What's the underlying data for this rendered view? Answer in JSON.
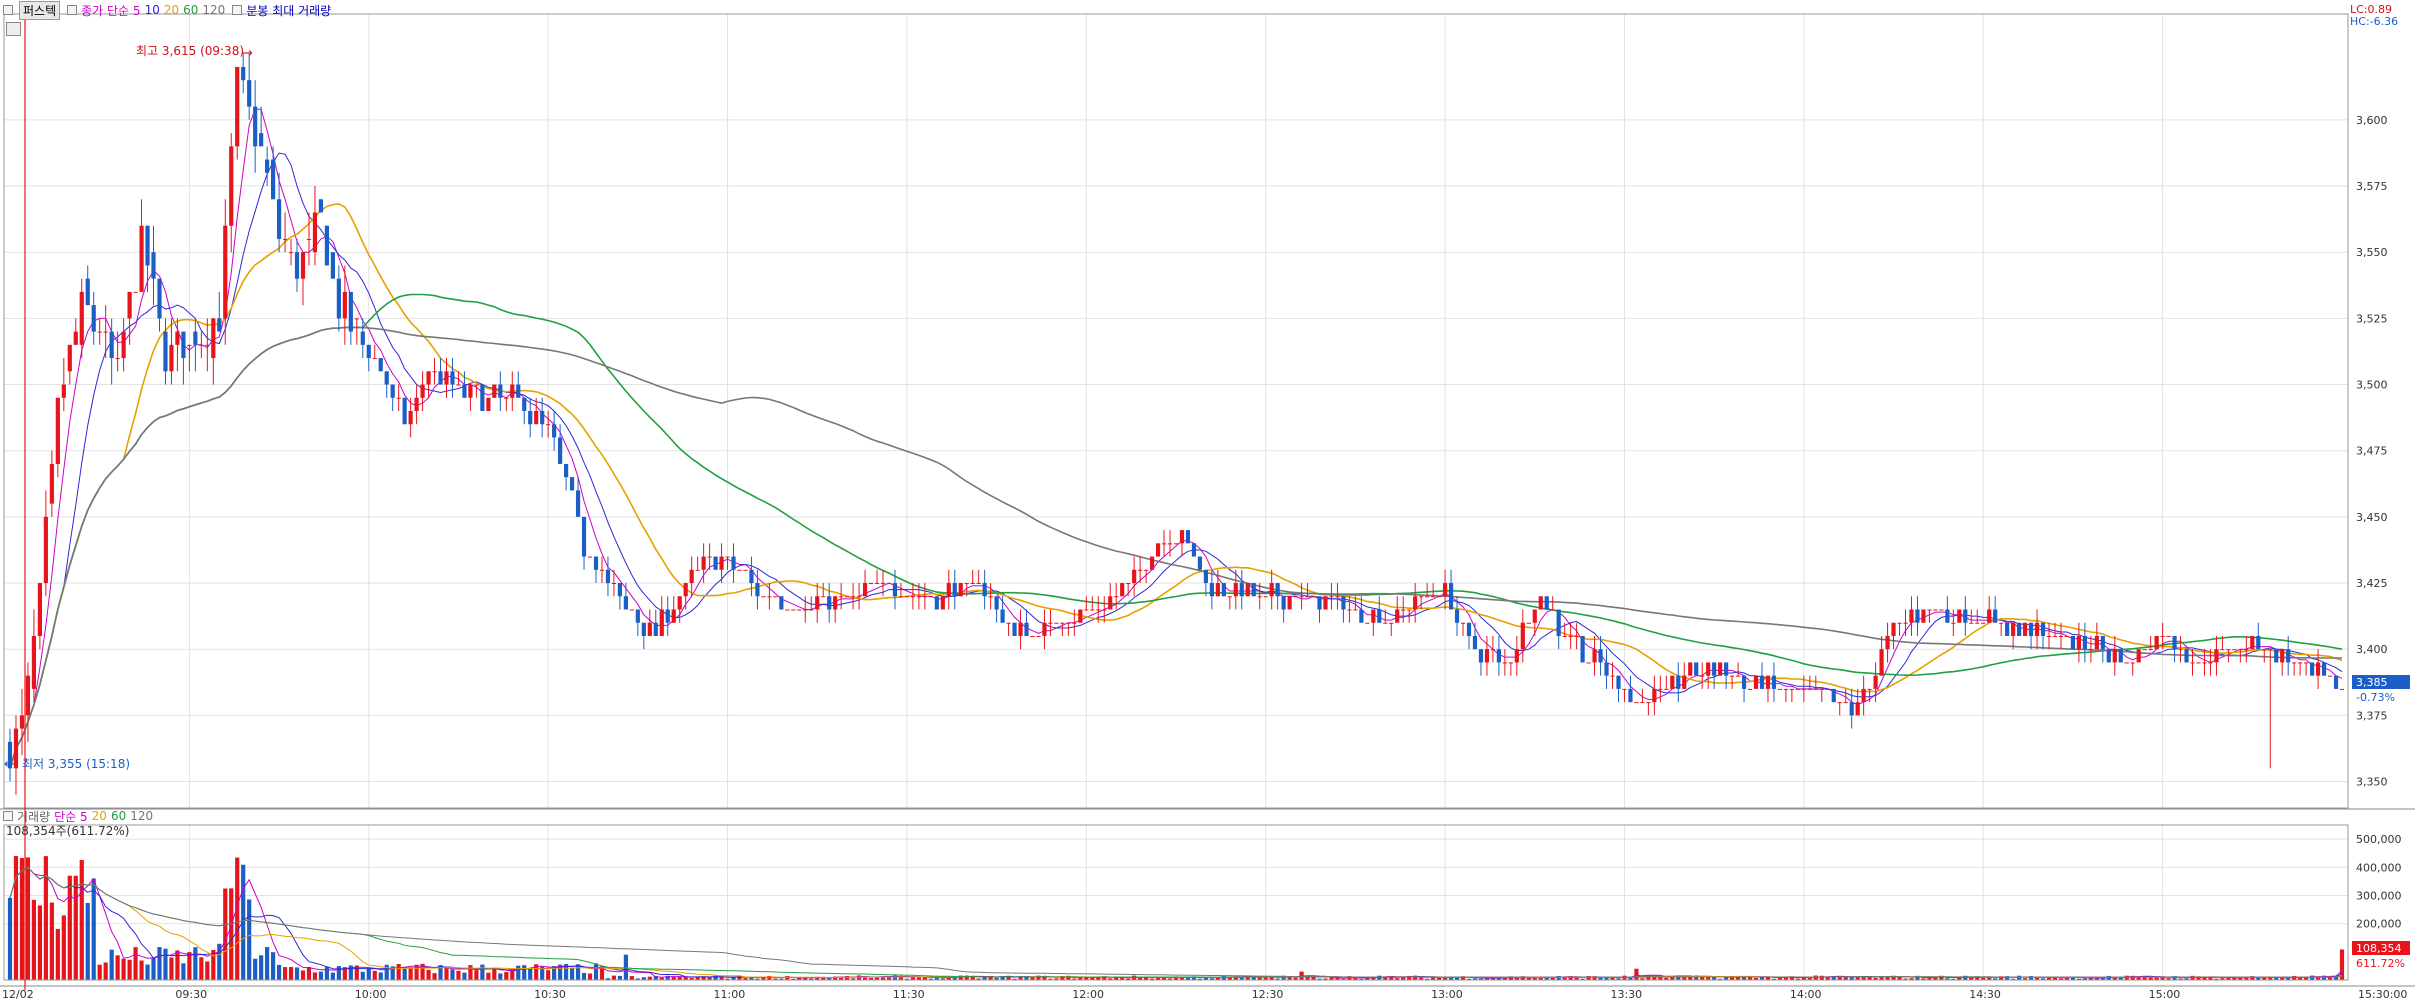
{
  "title_bar": {
    "name": "퍼스텍",
    "legend": [
      {
        "label": "종가 단순 5",
        "color": "#cc00cc"
      },
      {
        "label": "10",
        "color": "#2a2ad8"
      },
      {
        "label": "20",
        "color": "#e8a000"
      },
      {
        "label": "60",
        "color": "#20a040"
      },
      {
        "label": "120",
        "color": "#777777"
      },
      {
        "label": "분봉 최대 거래량",
        "color": "#0000c0"
      }
    ],
    "lc": "LC:0.89",
    "hc": "HC:-6.36"
  },
  "price_panel": {
    "high_label": "최고 3,615 (09:38)",
    "low_label": "최저 3,355 (15:18)",
    "current_price": "3,385",
    "current_change": "-0.73%",
    "y_ticks": [
      "3,600",
      "3,575",
      "3,550",
      "3,525",
      "3,500",
      "3,475",
      "3,450",
      "3,425",
      "3,400",
      "3,375",
      "3,350"
    ]
  },
  "volume_panel": {
    "legend": [
      {
        "label": "거래량",
        "color": "#666666"
      },
      {
        "label": "단순 5",
        "color": "#cc00cc"
      },
      {
        "label": "20",
        "color": "#e8a000"
      },
      {
        "label": "60",
        "color": "#20a040"
      },
      {
        "label": "120",
        "color": "#777777"
      }
    ],
    "value_label": "108,354주(611.72%)",
    "current_volume": "108,354",
    "current_pct": "611.72%",
    "y_ticks": [
      "500,000",
      "400,000",
      "300,000",
      "200,000"
    ]
  },
  "x_axis": {
    "date_label": "12/02",
    "ticks": [
      "09:30",
      "10:00",
      "10:30",
      "11:00",
      "11:30",
      "12:00",
      "12:30",
      "13:00",
      "13:30",
      "14:00",
      "14:30",
      "15:00"
    ],
    "end_label": "15:30:00"
  },
  "chart_data": {
    "type": "candlestick",
    "interval": "1 minute",
    "ylim": [
      3340,
      3640
    ],
    "volume_ylim": [
      0,
      550000
    ],
    "time_range": [
      "09:00",
      "15:30"
    ],
    "series": [
      {
        "name": "종가 단순 5",
        "kind": "moving-average"
      },
      {
        "name": "10",
        "kind": "moving-average"
      },
      {
        "name": "20",
        "kind": "moving-average"
      },
      {
        "name": "60",
        "kind": "moving-average"
      },
      {
        "name": "120",
        "kind": "moving-average"
      }
    ],
    "key_points": [
      {
        "time": "09:38",
        "price": 3615,
        "label": "최고"
      },
      {
        "time": "15:18",
        "price": 3355,
        "label": "최저"
      }
    ],
    "last_price": 3385,
    "last_volume": 108354,
    "grid": "on",
    "legend_placement": "top-left",
    "colors": {
      "up": "#e8141b",
      "down": "#1b5ec8",
      "grid": "#e2e2e2"
    }
  }
}
